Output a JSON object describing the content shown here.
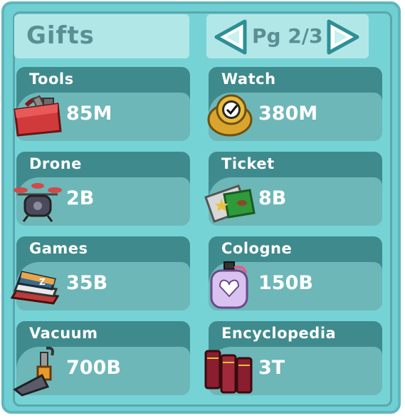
{
  "header": {
    "title": "Gifts",
    "page_label": "Pg 2/3"
  },
  "gifts": [
    {
      "label": "Tools",
      "price": "85M",
      "icon": "toolbox-icon"
    },
    {
      "label": "Watch",
      "price": "380M",
      "icon": "watch-icon"
    },
    {
      "label": "Drone",
      "price": "2B",
      "icon": "drone-icon"
    },
    {
      "label": "Ticket",
      "price": "8B",
      "icon": "ticket-icon"
    },
    {
      "label": "Games",
      "price": "35B",
      "icon": "games-icon"
    },
    {
      "label": "Cologne",
      "price": "150B",
      "icon": "cologne-icon"
    },
    {
      "label": "Vacuum",
      "price": "700B",
      "icon": "vacuum-icon"
    },
    {
      "label": "Encyclopedia",
      "price": "3T",
      "icon": "books-icon"
    }
  ]
}
